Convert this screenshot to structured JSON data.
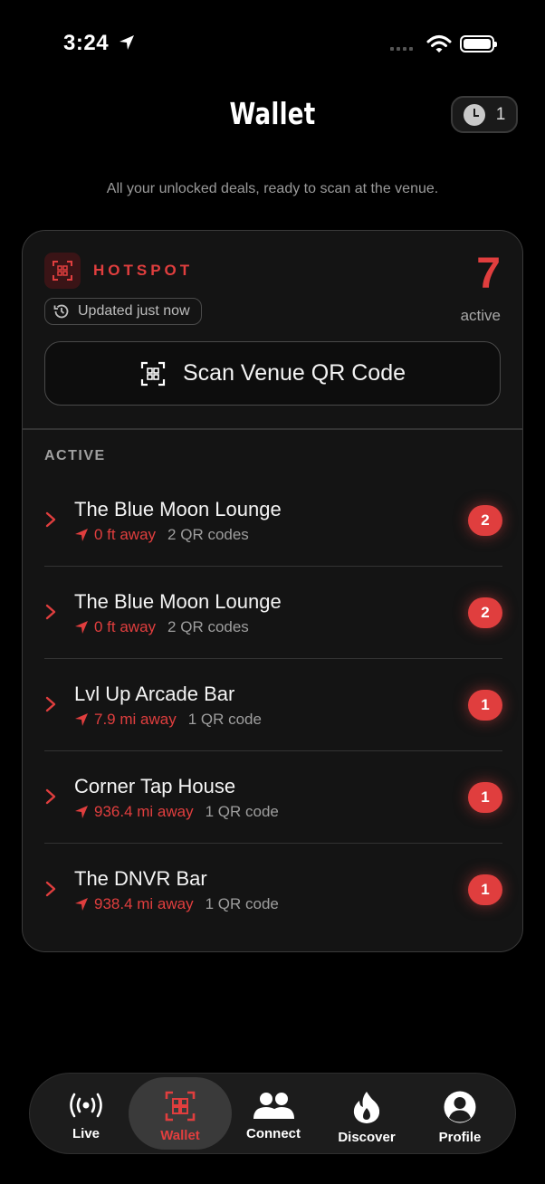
{
  "status": {
    "time": "3:24"
  },
  "header": {
    "title": "Wallet",
    "history_count": "1"
  },
  "subtitle": "All your unlocked deals, ready to scan at the venue.",
  "card": {
    "brand": "HOTSPOT",
    "updated": "Updated just now",
    "active_count": "7",
    "active_label": "active",
    "scan_button": "Scan Venue QR Code",
    "section_label": "ACTIVE",
    "venues": [
      {
        "name": "The Blue Moon Lounge",
        "distance": "0 ft away",
        "codes": "2 QR codes",
        "badge": "2"
      },
      {
        "name": "The Blue Moon Lounge",
        "distance": "0 ft away",
        "codes": "2 QR codes",
        "badge": "2"
      },
      {
        "name": "Lvl Up Arcade Bar",
        "distance": "7.9 mi away",
        "codes": "1 QR code",
        "badge": "1"
      },
      {
        "name": "Corner Tap House",
        "distance": "936.4 mi away",
        "codes": "1 QR code",
        "badge": "1"
      },
      {
        "name": "The DNVR Bar",
        "distance": "938.4 mi away",
        "codes": "1 QR code",
        "badge": "1"
      }
    ]
  },
  "tabs": [
    {
      "label": "Live",
      "icon": "broadcast-icon"
    },
    {
      "label": "Wallet",
      "icon": "qr-wallet-icon",
      "selected": true
    },
    {
      "label": "Connect",
      "icon": "people-icon"
    },
    {
      "label": "Discover",
      "icon": "flame-icon"
    },
    {
      "label": "Profile",
      "icon": "person-icon"
    }
  ],
  "colors": {
    "accent": "#e03e3e",
    "background": "#000000",
    "card": "#141414"
  }
}
